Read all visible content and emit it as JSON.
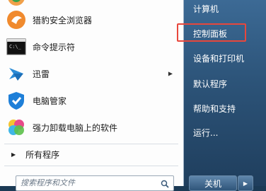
{
  "left_items": [
    {
      "label": "猎豹安全浏览器",
      "icon": "cheetah-browser-icon"
    },
    {
      "label": "命令提示符",
      "icon": "cmd-icon"
    },
    {
      "label": "迅雷",
      "icon": "xunlei-icon",
      "has_submenu": true
    },
    {
      "label": "电脑管家",
      "icon": "pc-manager-icon"
    },
    {
      "label": "强力卸载电脑上的软件",
      "icon": "uninstaller-icon"
    }
  ],
  "all_programs": {
    "label": "所有程序"
  },
  "search": {
    "placeholder": "搜索程序和文件"
  },
  "right_items": [
    {
      "label": "计算机"
    },
    {
      "label": "控制面板"
    },
    {
      "label": "设备和打印机"
    },
    {
      "label": "默认程序"
    },
    {
      "label": "帮助和支持"
    },
    {
      "label": "运行..."
    }
  ],
  "shutdown": {
    "label": "关机"
  },
  "colors": {
    "highlight": "#e8473c",
    "right_pane": "#2c5378"
  }
}
